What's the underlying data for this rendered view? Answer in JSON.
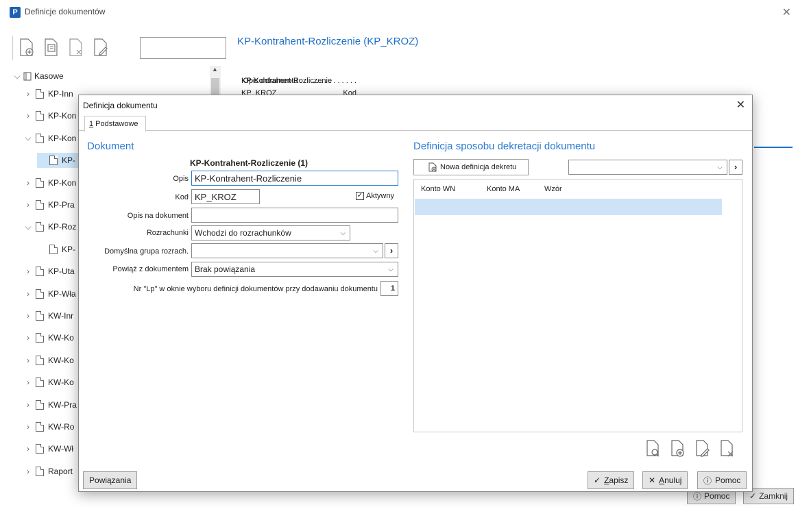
{
  "background_window": {
    "title": "Definicje dokumentów",
    "app_icon_letter": "P",
    "document_title": "KP-Kontrahent-Rozliczenie (KP_KROZ)",
    "info": {
      "opis_label": "Opis dokumentu . . . . . . . . . . . . . .",
      "opis_value": "KP-Kontrahent-Rozliczenie",
      "kod_label": "Kod",
      "kod_value": "KP_KROZ"
    },
    "tree": {
      "root": "Kasowe",
      "items": [
        {
          "label": "KP-Inn",
          "expanded": false
        },
        {
          "label": "KP-Kon",
          "expanded": false
        },
        {
          "label": "KP-Kon",
          "expanded": true
        },
        {
          "label": "KP-",
          "child": true,
          "selected": true
        },
        {
          "label": "KP-Kon",
          "expanded": false
        },
        {
          "label": "KP-Pra",
          "expanded": false
        },
        {
          "label": "KP-Roz",
          "expanded": true
        },
        {
          "label": "KP-",
          "child": true,
          "selected": false
        },
        {
          "label": "KP-Uta",
          "expanded": false
        },
        {
          "label": "KP-Wła",
          "expanded": false
        },
        {
          "label": "KW-Inr",
          "expanded": false
        },
        {
          "label": "KW-Ko",
          "expanded": false
        },
        {
          "label": "KW-Ko",
          "expanded": false
        },
        {
          "label": "KW-Ko",
          "expanded": false
        },
        {
          "label": "KW-Pra",
          "expanded": false
        },
        {
          "label": "KW-Ro",
          "expanded": false
        },
        {
          "label": "KW-Wł",
          "expanded": false
        },
        {
          "label": "Raport",
          "expanded": false
        }
      ]
    },
    "buttons": {
      "help": "Pomoc",
      "close": "Zamknij"
    }
  },
  "dialog": {
    "title": "Definicja dokumentu",
    "tab_number": "1",
    "tab_label": " Podstawowe",
    "dokument": {
      "section_title": "Dokument",
      "heading": "KP-Kontrahent-Rozliczenie (1)",
      "opis_label": "Opis",
      "opis_value": "KP-Kontrahent-Rozliczenie",
      "kod_label": "Kod",
      "kod_value": "KP_KROZ",
      "aktywny_label": "Aktywny",
      "aktywny_checked": true,
      "opis_na_dokument_label": "Opis na dokument",
      "opis_na_dokument_value": "",
      "rozrachunki_label": "Rozrachunki",
      "rozrachunki_value": "Wchodzi do rozrachunków",
      "domyslna_grupa_label": "Domyślna grupa rozrach.",
      "domyslna_grupa_value": "",
      "powiaz_label": "Powiąż z dokumentem",
      "powiaz_value": "Brak powiązania",
      "nr_lp_label": "Nr \"Lp\" w oknie wyboru definicji dokumentów przy dodawaniu dokumentu",
      "nr_lp_value": "1"
    },
    "dekretacja": {
      "section_title": "Definicja sposobu dekretacji dokumentu",
      "new_button": "Nowa definicja dekretu",
      "select_value": "",
      "columns": [
        "Konto WN",
        "Konto MA",
        "Wzór"
      ]
    },
    "footer": {
      "powiazania": "Powiązania",
      "zapisz_u": "Z",
      "zapisz_rest": "apisz",
      "anuluj_u": "A",
      "anuluj_rest": "nuluj",
      "pomoc": "Pomoc"
    }
  },
  "colors": {
    "accent": "#2b7bd3",
    "selection": "#cfe3f7"
  }
}
